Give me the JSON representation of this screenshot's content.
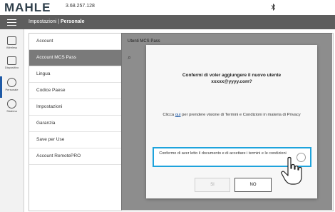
{
  "app": {
    "logo": "MAHLE",
    "version": "3.68.257.128"
  },
  "header": {
    "breadcrumb_prefix": "Impostazioni |",
    "breadcrumb_current": "Personale"
  },
  "rail": {
    "items": [
      {
        "label": "Wireless",
        "icon": "wireless-icon"
      },
      {
        "label": "Dispositivo",
        "icon": "device-icon"
      },
      {
        "label": "Personale",
        "icon": "settings-gear-icon"
      },
      {
        "label": "Sistema",
        "icon": "check-circle-icon"
      }
    ]
  },
  "menu": {
    "items": [
      {
        "label": "Account"
      },
      {
        "label": "Account MCS Pass"
      },
      {
        "label": "Lingua"
      },
      {
        "label": "Codice Paese"
      },
      {
        "label": "Impostazioni"
      },
      {
        "label": "Garanzia"
      },
      {
        "label": "Save per Use"
      },
      {
        "label": "Account RemotePRO"
      }
    ],
    "active_index": 1
  },
  "content": {
    "title": "Utenti MCS Pass"
  },
  "dialog": {
    "title_line1": "Confermi di voler aggiungere il nuovo utente",
    "title_line2": "xxxxx@yyyy.com?",
    "terms_prefix": "Clicca ",
    "terms_link": "qui",
    "terms_suffix": " per prendere visione di Termini e Condizioni in materia di Privacy",
    "confirm_text": "Confermo di aver letto il documento e di accettare i termini e le condizioni",
    "btn_yes": "SI",
    "btn_no": "NO"
  },
  "colors": {
    "accent": "#1ea3dc",
    "header": "#5d5d5d",
    "active": "#7a7a7a",
    "link": "#1f5aa6"
  }
}
